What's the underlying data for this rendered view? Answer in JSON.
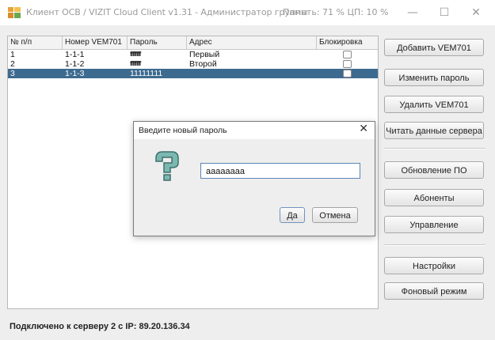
{
  "window": {
    "title": "Клиент OCB / VIZIT Cloud Client v1.31 - Администратор группы",
    "status_info": "Память: 71 %  ЦП: 10 %",
    "minimize_glyph": "—",
    "maximize_glyph": "☐",
    "close_glyph": "✕"
  },
  "table": {
    "headers": [
      "№ п/п",
      "Номер VEM701",
      "Пароль",
      "Адрес",
      "Блокировка"
    ],
    "rows": [
      {
        "num": "1",
        "vem": "1-1-1",
        "password": "ffffffff",
        "address": "Первый",
        "blocked": false
      },
      {
        "num": "2",
        "vem": "1-1-2",
        "password": "ffffffff",
        "address": "Второй",
        "blocked": false
      },
      {
        "num": "3",
        "vem": "1-1-3",
        "password": "11111111",
        "address": "",
        "blocked": false
      }
    ],
    "selected_row": 3
  },
  "buttons": {
    "add": "Добавить VEM701",
    "change_password": "Изменить пароль",
    "delete": "Удалить VEM701",
    "read_server": "Читать данные сервера",
    "update": "Обновление ПО",
    "subscribers": "Абоненты",
    "control": "Управление",
    "settings": "Настройки",
    "background": "Фоновый режим"
  },
  "status_bar": {
    "text": "Подключено к серверу 2 с IP:  89.20.136.34"
  },
  "dialog": {
    "title": "Введите новый пароль",
    "close_glyph": "✕",
    "input_value": "aaaaaaaa",
    "ok_label": "Да",
    "cancel_label": "Отмена"
  },
  "colors": {
    "selection": "#3d6a8f",
    "accent": "#5b86b5"
  }
}
